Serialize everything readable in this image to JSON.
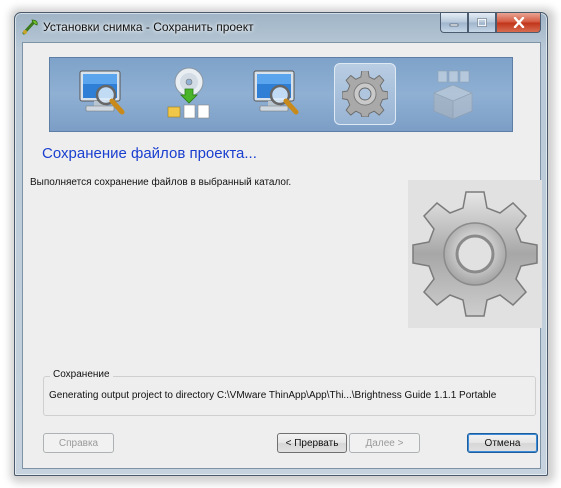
{
  "window": {
    "title": "Установки снимка - Сохранить проект"
  },
  "wizard_steps": [
    {
      "name": "scan-icon",
      "active": false
    },
    {
      "name": "install-icon",
      "active": false
    },
    {
      "name": "scan-icon",
      "active": false
    },
    {
      "name": "gear-icon",
      "active": true
    },
    {
      "name": "build-icon",
      "active": false
    }
  ],
  "page": {
    "heading": "Сохранение файлов проекта...",
    "description": "Выполняется сохранение файлов в выбранный каталог."
  },
  "status_group": {
    "label": "Сохранение",
    "path": "Generating output project to directory C:\\VMware ThinApp\\App\\Thi...\\Brightness Guide 1.1.1 Portable"
  },
  "buttons": {
    "help": "Справка",
    "back": "< Прервать",
    "next": "Далее >",
    "cancel": "Отмена"
  },
  "colors": {
    "heading": "#1a3fd0",
    "banner": "#8fb0d3",
    "close_button": "#c0331a"
  }
}
